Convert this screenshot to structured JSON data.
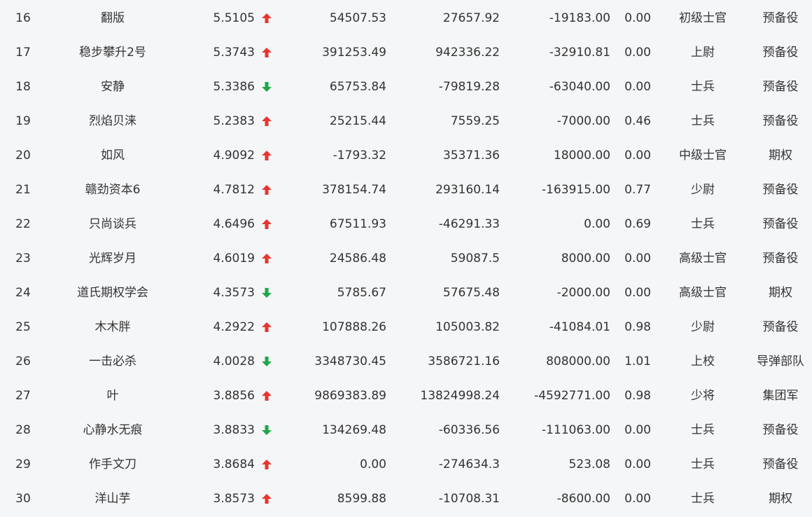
{
  "colors": {
    "up_arrow": "#e8352f",
    "down_arrow": "#1ea84a",
    "background": "#f5f6f8",
    "text": "#333333"
  },
  "rows": [
    {
      "rank": "16",
      "name": "翻版",
      "score": "5.5105",
      "trend": "up",
      "v1": "54507.53",
      "v2": "27657.92",
      "v3": "-19183.00",
      "v4": "0.00",
      "title": "初级士官",
      "unit": "预备役"
    },
    {
      "rank": "17",
      "name": "稳步攀升2号",
      "score": "5.3743",
      "trend": "up",
      "v1": "391253.49",
      "v2": "942336.22",
      "v3": "-32910.81",
      "v4": "0.00",
      "title": "上尉",
      "unit": "预备役"
    },
    {
      "rank": "18",
      "name": "安静",
      "score": "5.3386",
      "trend": "down",
      "v1": "65753.84",
      "v2": "-79819.28",
      "v3": "-63040.00",
      "v4": "0.00",
      "title": "士兵",
      "unit": "预备役"
    },
    {
      "rank": "19",
      "name": "烈焰贝涞",
      "score": "5.2383",
      "trend": "up",
      "v1": "25215.44",
      "v2": "7559.25",
      "v3": "-7000.00",
      "v4": "0.46",
      "title": "士兵",
      "unit": "预备役"
    },
    {
      "rank": "20",
      "name": "如风",
      "score": "4.9092",
      "trend": "up",
      "v1": "-1793.32",
      "v2": "35371.36",
      "v3": "18000.00",
      "v4": "0.00",
      "title": "中级士官",
      "unit": "期权"
    },
    {
      "rank": "21",
      "name": "赣劲资本6",
      "score": "4.7812",
      "trend": "up",
      "v1": "378154.74",
      "v2": "293160.14",
      "v3": "-163915.00",
      "v4": "0.77",
      "title": "少尉",
      "unit": "预备役"
    },
    {
      "rank": "22",
      "name": "只尚谈兵",
      "score": "4.6496",
      "trend": "up",
      "v1": "67511.93",
      "v2": "-46291.33",
      "v3": "0.00",
      "v4": "0.69",
      "title": "士兵",
      "unit": "预备役"
    },
    {
      "rank": "23",
      "name": "光辉岁月",
      "score": "4.6019",
      "trend": "up",
      "v1": "24586.48",
      "v2": "59087.5",
      "v3": "8000.00",
      "v4": "0.00",
      "title": "高级士官",
      "unit": "预备役"
    },
    {
      "rank": "24",
      "name": "道氏期权学会",
      "score": "4.3573",
      "trend": "down",
      "v1": "5785.67",
      "v2": "57675.48",
      "v3": "-2000.00",
      "v4": "0.00",
      "title": "高级士官",
      "unit": "期权"
    },
    {
      "rank": "25",
      "name": "木木胖",
      "score": "4.2922",
      "trend": "up",
      "v1": "107888.26",
      "v2": "105003.82",
      "v3": "-41084.01",
      "v4": "0.98",
      "title": "少尉",
      "unit": "预备役"
    },
    {
      "rank": "26",
      "name": "一击必杀",
      "score": "4.0028",
      "trend": "down",
      "v1": "3348730.45",
      "v2": "3586721.16",
      "v3": "808000.00",
      "v4": "1.01",
      "title": "上校",
      "unit": "导弹部队"
    },
    {
      "rank": "27",
      "name": "叶",
      "score": "3.8856",
      "trend": "up",
      "v1": "9869383.89",
      "v2": "13824998.24",
      "v3": "-4592771.00",
      "v4": "0.98",
      "title": "少将",
      "unit": "集团军"
    },
    {
      "rank": "28",
      "name": "心静水无痕",
      "score": "3.8833",
      "trend": "down",
      "v1": "134269.48",
      "v2": "-60336.56",
      "v3": "-111063.00",
      "v4": "0.00",
      "title": "士兵",
      "unit": "预备役"
    },
    {
      "rank": "29",
      "name": "作手文刀",
      "score": "3.8684",
      "trend": "up",
      "v1": "0.00",
      "v2": "-274634.3",
      "v3": "523.08",
      "v4": "0.00",
      "title": "士兵",
      "unit": "预备役"
    },
    {
      "rank": "30",
      "name": "洋山芋",
      "score": "3.8573",
      "trend": "up",
      "v1": "8599.88",
      "v2": "-10708.31",
      "v3": "-8600.00",
      "v4": "0.00",
      "title": "士兵",
      "unit": "期权"
    }
  ]
}
